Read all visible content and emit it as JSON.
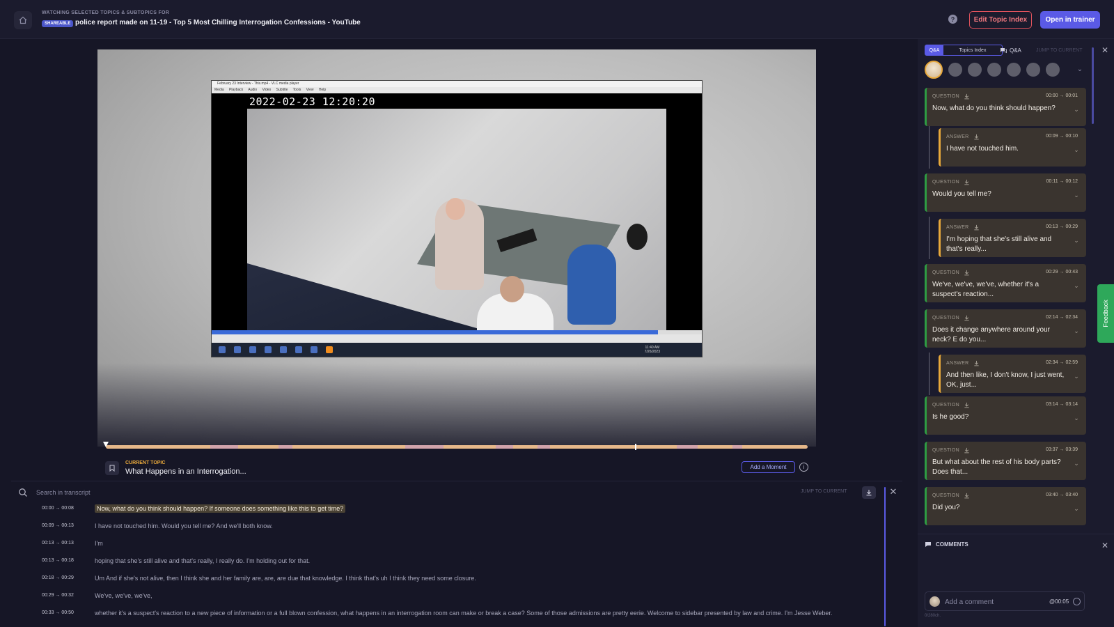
{
  "header": {
    "watching_label": "WATCHING SELECTED TOPICS & SUBTOPICS FOR",
    "shareable_badge": "SHAREABLE",
    "title": "police report made on 11-19 - Top 5 Most Chilling Interrogation Confessions - YouTube",
    "help_label": "?",
    "edit_button": "Edit Topic Index",
    "trainer_button": "Open in trainer"
  },
  "video": {
    "vlc_window_title": "February 23 Interview - This.mp4 - VLC media player",
    "vlc_menu": "Media Playback Audio Video Subtitle Tools View Help",
    "timestamp_overlay": "2022-02-23 12:20:20",
    "taskbar_time": "11:40 AM",
    "taskbar_date": "7/26/2023",
    "vlc_progress": 0.91
  },
  "player": {
    "progress": 0.0
  },
  "current_topic": {
    "label": "CURRENT TOPIC",
    "title": "What Happens in an Interrogation...",
    "add_moment": "Add a Moment",
    "info_icon": "i"
  },
  "transcript": {
    "search_placeholder": "Search in transcript",
    "jump_to_current": "JUMP TO CURRENT",
    "rows": [
      {
        "time": "00:00 → 00:08",
        "text": "Now, what do you think should happen? If someone does something like this to get time?",
        "active": true
      },
      {
        "time": "00:09 → 00:13",
        "text": "I have not touched him. Would you tell me? And we'll both know."
      },
      {
        "time": "00:13 → 00:13",
        "text": "I'm"
      },
      {
        "time": "00:13 → 00:18",
        "text": "hoping that she's still alive and that's really, I really do. I'm holding out for that."
      },
      {
        "time": "00:18 → 00:29",
        "text": "Um And if she's not alive, then I think she and her family are, are, are due that knowledge. I think that's uh I think they need some closure."
      },
      {
        "time": "00:29 → 00:32",
        "text": "We've, we've, we've,"
      },
      {
        "time": "00:33 → 00:50",
        "text": "whether it's a suspect's reaction to a new piece of information or a full blown confession, what happens in an interrogation room can make or break a case? Some of those admissions are pretty eerie. Welcome to sidebar presented by law and crime. I'm Jesse Weber."
      }
    ]
  },
  "qa_panel": {
    "tab_qa": "Q&A",
    "tab_topics": "Topics Index",
    "qa_label": "Q&A",
    "jump_to_current": "JUMP TO CURRENT",
    "cards": [
      {
        "kind": "QUESTION",
        "time": "00:00 → 00:01",
        "text": "Now, what do you think should happen?"
      },
      {
        "kind": "ANSWER",
        "time": "00:09 → 00:10",
        "text": "I have not touched him."
      },
      {
        "kind": "QUESTION",
        "time": "00:11 → 00:12",
        "text": "Would you tell me?"
      },
      {
        "kind": "ANSWER",
        "time": "00:13 → 00:29",
        "text": "I'm hoping that she's still alive and that's really..."
      },
      {
        "kind": "QUESTION",
        "time": "00:29 → 00:43",
        "text": "We've, we've, we've, whether it's a suspect's reaction..."
      },
      {
        "kind": "QUESTION",
        "time": "02:14 → 02:34",
        "text": "Does it change anywhere around your neck? E do you..."
      },
      {
        "kind": "ANSWER",
        "time": "02:34 → 02:59",
        "text": "And then like, I don't know, I just went, OK, just..."
      },
      {
        "kind": "QUESTION",
        "time": "03:14 → 03:14",
        "text": "Is he good?"
      },
      {
        "kind": "QUESTION",
        "time": "03:37 → 03:39",
        "text": "But what about the rest of his body parts? Does that..."
      },
      {
        "kind": "QUESTION",
        "time": "03:40 → 03:40",
        "text": "Did you?"
      }
    ]
  },
  "comments": {
    "title": "COMMENTS",
    "placeholder": "Add a comment",
    "timestamp": "@00:05",
    "char_count": "0/280ch."
  },
  "feedback_label": "Feedback",
  "colors": {
    "accent": "#5a5ae6",
    "edit_red": "#e0525c",
    "question_green": "#2e9c43",
    "answer_amber": "#e9a93b",
    "card_bg": "#3a342f"
  },
  "icons": [
    "home-icon",
    "help-icon",
    "bookmark-icon",
    "info-icon",
    "search-icon",
    "download-icon",
    "close-icon",
    "chevron-down-icon",
    "qa-icon",
    "comment-icon",
    "emoji-icon",
    "feedback-icon"
  ]
}
